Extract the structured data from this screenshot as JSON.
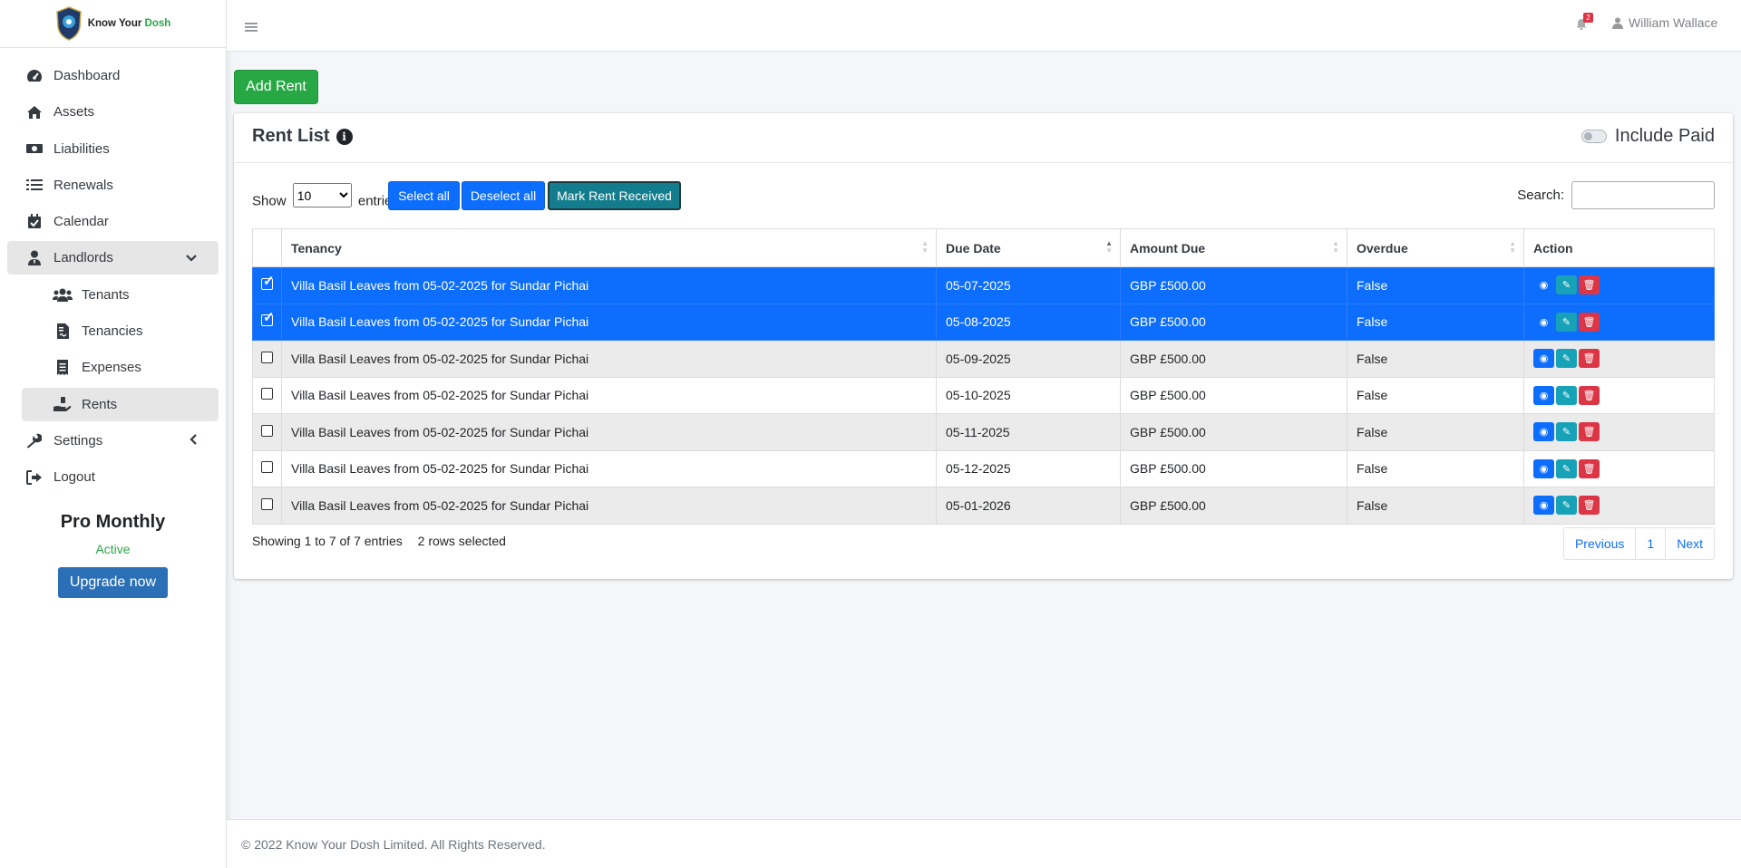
{
  "brand": {
    "name_prefix": "Know Your ",
    "name_accent": "Dosh",
    "accent_color": "#28a745"
  },
  "sidebar": {
    "items": [
      {
        "label": "Dashboard",
        "icon": "speedometer-icon"
      },
      {
        "label": "Assets",
        "icon": "house-icon"
      },
      {
        "label": "Liabilities",
        "icon": "money-bill-icon"
      },
      {
        "label": "Renewals",
        "icon": "list-icon"
      },
      {
        "label": "Calendar",
        "icon": "calendar-check-icon"
      },
      {
        "label": "Landlords",
        "icon": "user-tie-icon"
      },
      {
        "label": "Tenants",
        "icon": "users-icon"
      },
      {
        "label": "Tenancies",
        "icon": "file-contract-icon"
      },
      {
        "label": "Expenses",
        "icon": "receipt-icon"
      },
      {
        "label": "Rents",
        "icon": "hand-holding-icon"
      },
      {
        "label": "Settings",
        "icon": "wrench-icon"
      },
      {
        "label": "Logout",
        "icon": "sign-out-icon"
      }
    ],
    "plan": {
      "name": "Pro Monthly",
      "status": "Active",
      "upgrade_label": "Upgrade now"
    }
  },
  "header": {
    "notification_count": "2",
    "user_name": "William Wallace"
  },
  "main": {
    "add_rent_label": "Add Rent",
    "card_title": "Rent List",
    "include_paid_label": "Include Paid",
    "show_label": "Show",
    "entries_label": "entries",
    "page_size": "10",
    "select_all_label": "Select all",
    "deselect_all_label": "Deselect all",
    "mark_received_label": "Mark Rent Received",
    "search_label": "Search:",
    "search_value": "",
    "columns": [
      "Tenancy",
      "Due Date",
      "Amount Due",
      "Overdue",
      "Action"
    ],
    "rows": [
      {
        "tenancy": "Villa Basil Leaves from 05-02-2025 for Sundar Pichai",
        "due": "05-07-2025",
        "amount": "GBP £500.00",
        "overdue": "False",
        "selected": true
      },
      {
        "tenancy": "Villa Basil Leaves from 05-02-2025 for Sundar Pichai",
        "due": "05-08-2025",
        "amount": "GBP £500.00",
        "overdue": "False",
        "selected": true
      },
      {
        "tenancy": "Villa Basil Leaves from 05-02-2025 for Sundar Pichai",
        "due": "05-09-2025",
        "amount": "GBP £500.00",
        "overdue": "False",
        "selected": false
      },
      {
        "tenancy": "Villa Basil Leaves from 05-02-2025 for Sundar Pichai",
        "due": "05-10-2025",
        "amount": "GBP £500.00",
        "overdue": "False",
        "selected": false
      },
      {
        "tenancy": "Villa Basil Leaves from 05-02-2025 for Sundar Pichai",
        "due": "05-11-2025",
        "amount": "GBP £500.00",
        "overdue": "False",
        "selected": false
      },
      {
        "tenancy": "Villa Basil Leaves from 05-02-2025 for Sundar Pichai",
        "due": "05-12-2025",
        "amount": "GBP £500.00",
        "overdue": "False",
        "selected": false
      },
      {
        "tenancy": "Villa Basil Leaves from 05-02-2025 for Sundar Pichai",
        "due": "05-01-2026",
        "amount": "GBP £500.00",
        "overdue": "False",
        "selected": false
      }
    ],
    "showing_text": "Showing 1 to 7 of 7 entries",
    "selected_text": "2 rows selected",
    "pagination": {
      "previous": "Previous",
      "page": "1",
      "next": "Next"
    }
  },
  "footer": {
    "text": "© 2022 Know Your Dosh Limited. All Rights Reserved."
  }
}
